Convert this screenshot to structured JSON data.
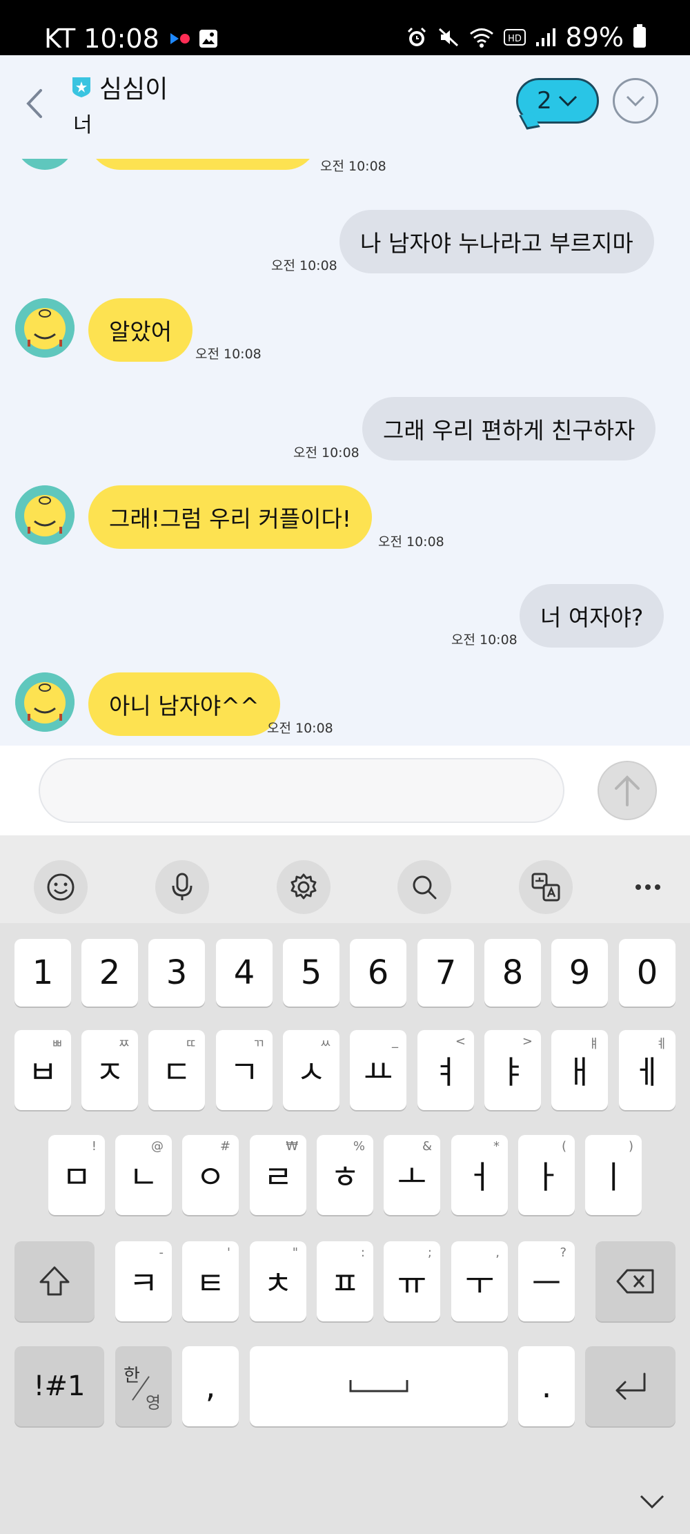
{
  "status_bar": {
    "carrier_time": "KT 10:08",
    "battery": "89%"
  },
  "header": {
    "title": "심심이",
    "subtitle": "너",
    "member_count": "2"
  },
  "messages": [
    {
      "side": "in",
      "text": "",
      "time": "오전 10:08"
    },
    {
      "side": "out",
      "text": "나 남자야 누나라고 부르지마",
      "time": "오전 10:08"
    },
    {
      "side": "in",
      "text": "알았어",
      "time": "오전 10:08"
    },
    {
      "side": "out",
      "text": "그래 우리 편하게 친구하자",
      "time": "오전 10:08"
    },
    {
      "side": "in",
      "text": "그래!그럼 우리 커플이다!",
      "time": "오전 10:08"
    },
    {
      "side": "out",
      "text": "너 여자야?",
      "time": "오전 10:08"
    },
    {
      "side": "in",
      "text": "아니 남자야^^",
      "time": "오전 10:08"
    }
  ],
  "input": {
    "value": "",
    "placeholder": ""
  },
  "keyboard": {
    "toolbar_icons": [
      "emoji-icon",
      "microphone-icon",
      "settings-icon",
      "search-icon",
      "translate-icon",
      "more-icon"
    ],
    "row_numbers": [
      "1",
      "2",
      "3",
      "4",
      "5",
      "6",
      "7",
      "8",
      "9",
      "0"
    ],
    "row1": [
      {
        "key": "ㅂ",
        "hint": "ㅃ"
      },
      {
        "key": "ㅈ",
        "hint": "ㅉ"
      },
      {
        "key": "ㄷ",
        "hint": "ㄸ"
      },
      {
        "key": "ㄱ",
        "hint": "ㄲ"
      },
      {
        "key": "ㅅ",
        "hint": "ㅆ"
      },
      {
        "key": "ㅛ",
        "hint": "_"
      },
      {
        "key": "ㅕ",
        "hint": "<"
      },
      {
        "key": "ㅑ",
        "hint": ">"
      },
      {
        "key": "ㅐ",
        "hint": "ㅒ"
      },
      {
        "key": "ㅔ",
        "hint": "ㅖ"
      }
    ],
    "row2": [
      {
        "key": "ㅁ",
        "hint": "!"
      },
      {
        "key": "ㄴ",
        "hint": "@"
      },
      {
        "key": "ㅇ",
        "hint": "#"
      },
      {
        "key": "ㄹ",
        "hint": "₩"
      },
      {
        "key": "ㅎ",
        "hint": "%"
      },
      {
        "key": "ㅗ",
        "hint": "&"
      },
      {
        "key": "ㅓ",
        "hint": "*"
      },
      {
        "key": "ㅏ",
        "hint": "("
      },
      {
        "key": "ㅣ",
        "hint": ")"
      }
    ],
    "row3": [
      {
        "key": "ㅋ",
        "hint": "-"
      },
      {
        "key": "ㅌ",
        "hint": "'"
      },
      {
        "key": "ㅊ",
        "hint": "\""
      },
      {
        "key": "ㅍ",
        "hint": ":"
      },
      {
        "key": "ㅠ",
        "hint": ";"
      },
      {
        "key": "ㅜ",
        "hint": ","
      },
      {
        "key": "ㅡ",
        "hint": "?"
      }
    ],
    "symbols_label": "!#1",
    "lang_top": "한",
    "lang_bottom": "영",
    "comma": ",",
    "period": "."
  }
}
